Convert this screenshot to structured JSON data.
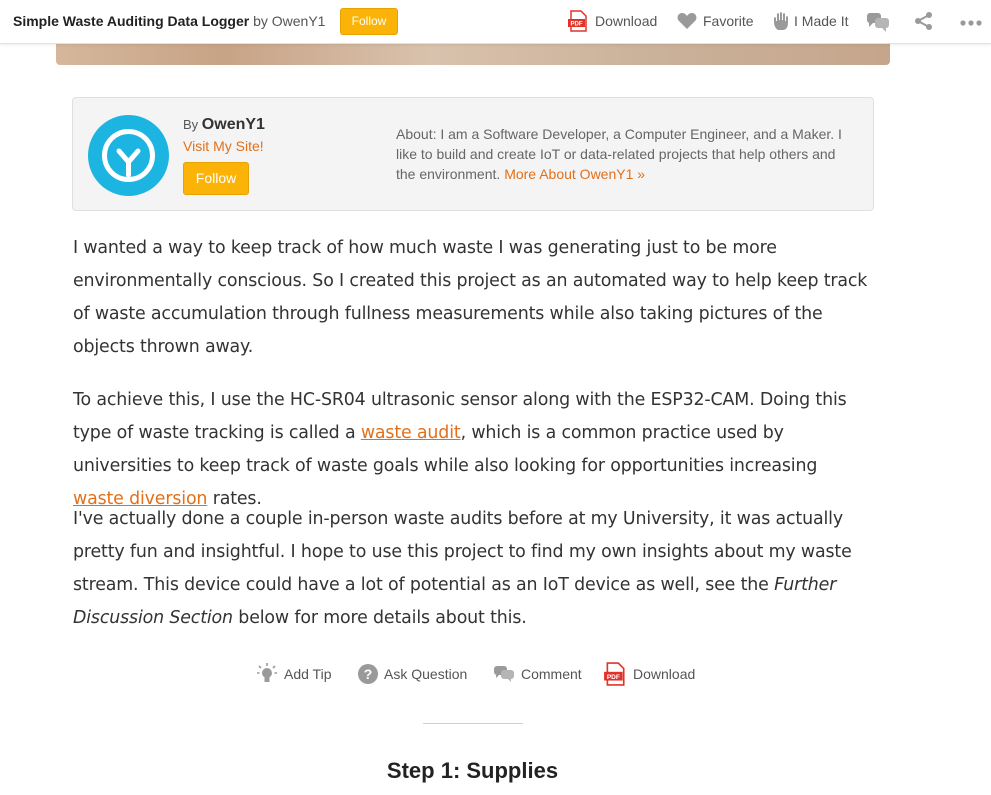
{
  "topbar": {
    "title": "Simple Waste Auditing Data Logger",
    "by_text": "by OwenY1",
    "follow_label": "Follow",
    "download_label": "Download",
    "favorite_label": "Favorite",
    "made_it_label": "I Made It"
  },
  "author": {
    "by_prefix": "By",
    "name": "OwenY1",
    "site_link": "Visit My Site!",
    "follow_label": "Follow",
    "about": "About: I am a Software Developer, a Computer Engineer, and a Maker. I like to build and create IoT or data-related projects that help others and the environment.",
    "more_link": "More About OwenY1 »"
  },
  "body": {
    "p1": "I wanted a way to keep track of how much waste I was generating just to be more environmentally conscious. So I created this project as an automated way to help keep track of waste accumulation through fullness measurements while also taking pictures of the objects thrown away.",
    "p2_a": "To achieve this, I use the HC-SR04 ultrasonic sensor along with the ESP32-CAM. Doing this type of waste tracking is called a ",
    "p2_link1": "waste audit",
    "p2_b": ", which is a common practice used by universities to keep track of waste goals while also looking for opportunities increasing ",
    "p2_link2": "waste diversion",
    "p2_c": " rates.",
    "p3_a": "I've actually done a couple in-person waste audits before at my University, it was actually pretty fun and insightful. I hope to use this project to find my own insights about my waste stream. This device could have a lot of potential as an IoT device as well, see the ",
    "p3_italic": "Further Discussion Section",
    "p3_b": " below for more details about this."
  },
  "actions": {
    "add_tip": "Add Tip",
    "ask_question": "Ask Question",
    "comment": "Comment",
    "download": "Download"
  },
  "step": {
    "title": "Step 1: Supplies"
  },
  "colors": {
    "accent_orange": "#e2701a",
    "follow_yellow": "#fab306",
    "avatar_blue": "#1cb4e0",
    "pdf_red": "#e0332c"
  },
  "icons": [
    "pdf-icon",
    "heart-icon",
    "hand-icon",
    "comment-icon",
    "share-icon",
    "more-icon",
    "lightbulb-icon",
    "question-icon"
  ]
}
